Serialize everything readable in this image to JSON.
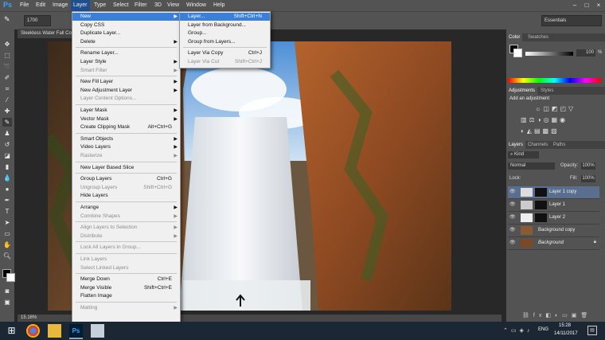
{
  "menubar": {
    "items": [
      "File",
      "Edit",
      "Image",
      "Layer",
      "Type",
      "Select",
      "Filter",
      "3D",
      "View",
      "Window",
      "Help"
    ],
    "active": "Layer"
  },
  "options": {
    "brush_size": "1700",
    "workspace": "Essentials"
  },
  "document": {
    "tab_title": "Sleekless Water Fall Co...",
    "zoom": "15.16%"
  },
  "layer_menu": [
    {
      "label": "New",
      "shortcut": "",
      "submenu": true,
      "disabled": false,
      "highlight": true
    },
    {
      "label": "Copy CSS",
      "shortcut": "",
      "submenu": false,
      "disabled": false
    },
    {
      "label": "Duplicate Layer...",
      "shortcut": "",
      "submenu": false,
      "disabled": false
    },
    {
      "label": "Delete",
      "shortcut": "",
      "submenu": true,
      "disabled": false,
      "sep_after": true
    },
    {
      "label": "Rename Layer...",
      "shortcut": "",
      "submenu": false,
      "disabled": false
    },
    {
      "label": "Layer Style",
      "shortcut": "",
      "submenu": true,
      "disabled": false
    },
    {
      "label": "Smart Filter",
      "shortcut": "",
      "submenu": true,
      "disabled": true,
      "sep_after": true
    },
    {
      "label": "New Fill Layer",
      "shortcut": "",
      "submenu": true,
      "disabled": false
    },
    {
      "label": "New Adjustment Layer",
      "shortcut": "",
      "submenu": true,
      "disabled": false
    },
    {
      "label": "Layer Content Options...",
      "shortcut": "",
      "submenu": false,
      "disabled": true,
      "sep_after": true
    },
    {
      "label": "Layer Mask",
      "shortcut": "",
      "submenu": true,
      "disabled": false
    },
    {
      "label": "Vector Mask",
      "shortcut": "",
      "submenu": true,
      "disabled": false
    },
    {
      "label": "Create Clipping Mask",
      "shortcut": "Alt+Ctrl+G",
      "submenu": false,
      "disabled": false,
      "sep_after": true
    },
    {
      "label": "Smart Objects",
      "shortcut": "",
      "submenu": true,
      "disabled": false
    },
    {
      "label": "Video Layers",
      "shortcut": "",
      "submenu": true,
      "disabled": false
    },
    {
      "label": "Rasterize",
      "shortcut": "",
      "submenu": true,
      "disabled": true,
      "sep_after": true
    },
    {
      "label": "New Layer Based Slice",
      "shortcut": "",
      "submenu": false,
      "disabled": false,
      "sep_after": true
    },
    {
      "label": "Group Layers",
      "shortcut": "Ctrl+G",
      "submenu": false,
      "disabled": false
    },
    {
      "label": "Ungroup Layers",
      "shortcut": "Shift+Ctrl+G",
      "submenu": false,
      "disabled": true
    },
    {
      "label": "Hide Layers",
      "shortcut": "",
      "submenu": false,
      "disabled": false,
      "sep_after": true
    },
    {
      "label": "Arrange",
      "shortcut": "",
      "submenu": true,
      "disabled": false
    },
    {
      "label": "Combine Shapes",
      "shortcut": "",
      "submenu": true,
      "disabled": true,
      "sep_after": true
    },
    {
      "label": "Align Layers to Selection",
      "shortcut": "",
      "submenu": true,
      "disabled": true
    },
    {
      "label": "Distribute",
      "shortcut": "",
      "submenu": true,
      "disabled": true,
      "sep_after": true
    },
    {
      "label": "Lock All Layers in Group...",
      "shortcut": "",
      "submenu": false,
      "disabled": true,
      "sep_after": true
    },
    {
      "label": "Link Layers",
      "shortcut": "",
      "submenu": false,
      "disabled": true
    },
    {
      "label": "Select Linked Layers",
      "shortcut": "",
      "submenu": false,
      "disabled": true,
      "sep_after": true
    },
    {
      "label": "Merge Down",
      "shortcut": "Ctrl+E",
      "submenu": false,
      "disabled": false
    },
    {
      "label": "Merge Visible",
      "shortcut": "Shift+Ctrl+E",
      "submenu": false,
      "disabled": false
    },
    {
      "label": "Flatten Image",
      "shortcut": "",
      "submenu": false,
      "disabled": false,
      "sep_after": true
    },
    {
      "label": "Matting",
      "shortcut": "",
      "submenu": true,
      "disabled": true
    }
  ],
  "new_submenu": [
    {
      "label": "Layer...",
      "shortcut": "Shift+Ctrl+N",
      "disabled": false,
      "highlight": true
    },
    {
      "label": "Layer from Background...",
      "shortcut": "",
      "disabled": false
    },
    {
      "label": "Group...",
      "shortcut": "",
      "disabled": false
    },
    {
      "label": "Group from Layers...",
      "shortcut": "",
      "disabled": false,
      "sep_after": true
    },
    {
      "label": "Layer Via Copy",
      "shortcut": "Ctrl+J",
      "disabled": false
    },
    {
      "label": "Layer Via Cut",
      "shortcut": "Shift+Ctrl+J",
      "disabled": true
    }
  ],
  "color_panel": {
    "tabs": [
      "Color",
      "Swatches"
    ],
    "k_value": "100",
    "k_unit": "%"
  },
  "adjustments_panel": {
    "tabs": [
      "Adjustments",
      "Styles"
    ],
    "heading": "Add an adjustment"
  },
  "layers_panel": {
    "tabs": [
      "Layers",
      "Channels",
      "Paths"
    ],
    "kind_label": "Kind",
    "blend_mode": "Normal",
    "opacity_label": "Opacity:",
    "opacity": "100%",
    "lock_label": "Lock:",
    "fill_label": "Fill:",
    "fill": "100%",
    "layers": [
      {
        "name": "Layer 1 copy",
        "selected": true
      },
      {
        "name": "Layer 1",
        "selected": false
      },
      {
        "name": "Layer 2",
        "selected": false
      },
      {
        "name": "Background copy",
        "selected": false
      },
      {
        "name": "Background",
        "selected": false
      }
    ]
  },
  "taskbar": {
    "lang": "ENG",
    "time": "15:28",
    "date": "14/11/2017"
  }
}
